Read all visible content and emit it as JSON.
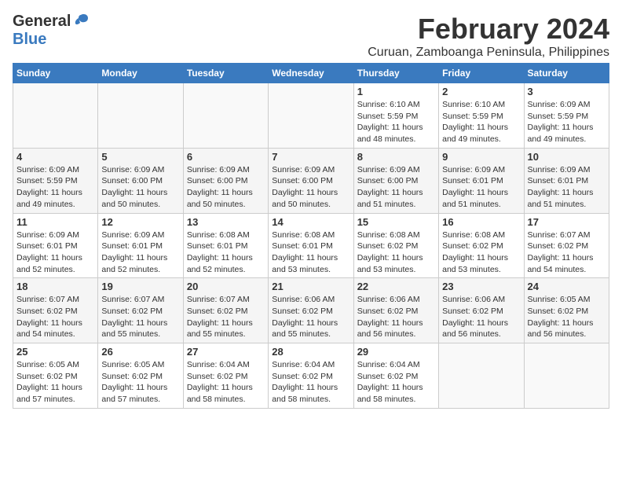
{
  "logo": {
    "general": "General",
    "blue": "Blue"
  },
  "title": "February 2024",
  "location": "Curuan, Zamboanga Peninsula, Philippines",
  "days_of_week": [
    "Sunday",
    "Monday",
    "Tuesday",
    "Wednesday",
    "Thursday",
    "Friday",
    "Saturday"
  ],
  "weeks": [
    [
      {
        "day": "",
        "info": ""
      },
      {
        "day": "",
        "info": ""
      },
      {
        "day": "",
        "info": ""
      },
      {
        "day": "",
        "info": ""
      },
      {
        "day": "1",
        "info": "Sunrise: 6:10 AM\nSunset: 5:59 PM\nDaylight: 11 hours and 48 minutes."
      },
      {
        "day": "2",
        "info": "Sunrise: 6:10 AM\nSunset: 5:59 PM\nDaylight: 11 hours and 49 minutes."
      },
      {
        "day": "3",
        "info": "Sunrise: 6:09 AM\nSunset: 5:59 PM\nDaylight: 11 hours and 49 minutes."
      }
    ],
    [
      {
        "day": "4",
        "info": "Sunrise: 6:09 AM\nSunset: 5:59 PM\nDaylight: 11 hours and 49 minutes."
      },
      {
        "day": "5",
        "info": "Sunrise: 6:09 AM\nSunset: 6:00 PM\nDaylight: 11 hours and 50 minutes."
      },
      {
        "day": "6",
        "info": "Sunrise: 6:09 AM\nSunset: 6:00 PM\nDaylight: 11 hours and 50 minutes."
      },
      {
        "day": "7",
        "info": "Sunrise: 6:09 AM\nSunset: 6:00 PM\nDaylight: 11 hours and 50 minutes."
      },
      {
        "day": "8",
        "info": "Sunrise: 6:09 AM\nSunset: 6:00 PM\nDaylight: 11 hours and 51 minutes."
      },
      {
        "day": "9",
        "info": "Sunrise: 6:09 AM\nSunset: 6:01 PM\nDaylight: 11 hours and 51 minutes."
      },
      {
        "day": "10",
        "info": "Sunrise: 6:09 AM\nSunset: 6:01 PM\nDaylight: 11 hours and 51 minutes."
      }
    ],
    [
      {
        "day": "11",
        "info": "Sunrise: 6:09 AM\nSunset: 6:01 PM\nDaylight: 11 hours and 52 minutes."
      },
      {
        "day": "12",
        "info": "Sunrise: 6:09 AM\nSunset: 6:01 PM\nDaylight: 11 hours and 52 minutes."
      },
      {
        "day": "13",
        "info": "Sunrise: 6:08 AM\nSunset: 6:01 PM\nDaylight: 11 hours and 52 minutes."
      },
      {
        "day": "14",
        "info": "Sunrise: 6:08 AM\nSunset: 6:01 PM\nDaylight: 11 hours and 53 minutes."
      },
      {
        "day": "15",
        "info": "Sunrise: 6:08 AM\nSunset: 6:02 PM\nDaylight: 11 hours and 53 minutes."
      },
      {
        "day": "16",
        "info": "Sunrise: 6:08 AM\nSunset: 6:02 PM\nDaylight: 11 hours and 53 minutes."
      },
      {
        "day": "17",
        "info": "Sunrise: 6:07 AM\nSunset: 6:02 PM\nDaylight: 11 hours and 54 minutes."
      }
    ],
    [
      {
        "day": "18",
        "info": "Sunrise: 6:07 AM\nSunset: 6:02 PM\nDaylight: 11 hours and 54 minutes."
      },
      {
        "day": "19",
        "info": "Sunrise: 6:07 AM\nSunset: 6:02 PM\nDaylight: 11 hours and 55 minutes."
      },
      {
        "day": "20",
        "info": "Sunrise: 6:07 AM\nSunset: 6:02 PM\nDaylight: 11 hours and 55 minutes."
      },
      {
        "day": "21",
        "info": "Sunrise: 6:06 AM\nSunset: 6:02 PM\nDaylight: 11 hours and 55 minutes."
      },
      {
        "day": "22",
        "info": "Sunrise: 6:06 AM\nSunset: 6:02 PM\nDaylight: 11 hours and 56 minutes."
      },
      {
        "day": "23",
        "info": "Sunrise: 6:06 AM\nSunset: 6:02 PM\nDaylight: 11 hours and 56 minutes."
      },
      {
        "day": "24",
        "info": "Sunrise: 6:05 AM\nSunset: 6:02 PM\nDaylight: 11 hours and 56 minutes."
      }
    ],
    [
      {
        "day": "25",
        "info": "Sunrise: 6:05 AM\nSunset: 6:02 PM\nDaylight: 11 hours and 57 minutes."
      },
      {
        "day": "26",
        "info": "Sunrise: 6:05 AM\nSunset: 6:02 PM\nDaylight: 11 hours and 57 minutes."
      },
      {
        "day": "27",
        "info": "Sunrise: 6:04 AM\nSunset: 6:02 PM\nDaylight: 11 hours and 58 minutes."
      },
      {
        "day": "28",
        "info": "Sunrise: 6:04 AM\nSunset: 6:02 PM\nDaylight: 11 hours and 58 minutes."
      },
      {
        "day": "29",
        "info": "Sunrise: 6:04 AM\nSunset: 6:02 PM\nDaylight: 11 hours and 58 minutes."
      },
      {
        "day": "",
        "info": ""
      },
      {
        "day": "",
        "info": ""
      }
    ]
  ]
}
